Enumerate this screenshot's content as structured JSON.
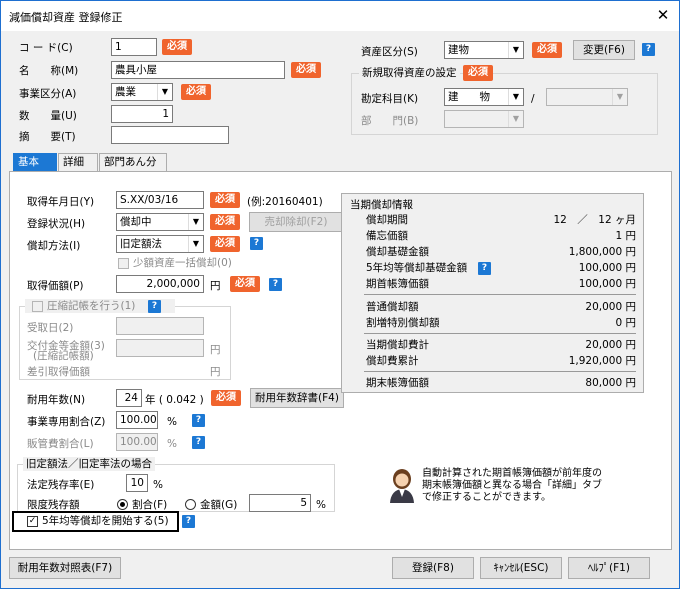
{
  "window": {
    "title": "減価償却資産 登録修正",
    "close_label": "✕"
  },
  "required_label": "必須",
  "help_label": "?",
  "header": {
    "code_label": "コ ー ド(C)",
    "code_value": "1",
    "name_label": "名　　称(M)",
    "name_value": "農具小屋",
    "business_label": "事業区分(A)",
    "business_value": "農業",
    "quantity_label": "数　　量(U)",
    "quantity_value": "1",
    "summary_label": "摘　　要(T)",
    "summary_value": "",
    "asset_class_label": "資産区分(S)",
    "asset_class_value": "建物",
    "change_button": "変更(F6)",
    "new_setting_title": "新規取得資産の設定",
    "account_label": "勘定科目(K)",
    "account_value": "建　　物",
    "account_sep": "/",
    "dept_label": "部　　門(B)"
  },
  "tabs": [
    {
      "label": "基本"
    },
    {
      "label": "詳細"
    },
    {
      "label": "部門あん分"
    }
  ],
  "form": {
    "acq_date_label": "取得年月日(Y)",
    "acq_date_value": "S.XX/03/16",
    "acq_date_example": "(例:20160401)",
    "reg_status_label": "登録状況(H)",
    "reg_status_value": "償却中",
    "sell_remove_button": "売却除却(F2)",
    "method_label": "償却方法(I)",
    "method_value": "旧定額法",
    "small_asset_label": "少額資産一括償却(0)",
    "acq_price_label": "取得価額(P)",
    "acq_price_value": "2,000,000",
    "yen": "円",
    "compress_label": "圧縮記帳を行う(1)",
    "received_date_label": "受取日(2)",
    "grant_label_1": "交付金等金額(3)",
    "grant_label_2": "(圧縮記帳額)",
    "deduct_label": "差引取得価額",
    "life_label": "耐用年数(N)",
    "life_value": "24",
    "life_unit": "年 ( 0.042 )",
    "life_table_button": "耐用年数辞書(F4)",
    "business_ratio_label": "事業専用割合(Z)",
    "business_ratio_value": "100.00",
    "pct": "%",
    "admin_ratio_label": "販管費割合(L)",
    "admin_ratio_value": "100.00",
    "old_method_title": "旧定額法／旧定率法の場合",
    "legal_residual_label": "法定残存率(E)",
    "legal_residual_value": "10",
    "limit_residual_label": "限度残存額",
    "ratio_option": "割合(F)",
    "amount_option": "金額(G)",
    "limit_residual_value": "5",
    "five_year_label": "5年均等償却を開始する(5)"
  },
  "info": {
    "title": "当期償却情報",
    "rows": [
      {
        "label": "償却期間",
        "value": "12　／　12 ヶ月"
      },
      {
        "label": "備忘価額",
        "value": "1 円"
      },
      {
        "label": "償却基礎金額",
        "value": "1,800,000 円"
      },
      {
        "label": "5年均等償却基礎金額",
        "value": "100,000 円"
      },
      {
        "label": "期首帳簿価額",
        "value": "100,000 円"
      },
      {
        "label": "普通償却額",
        "value": "20,000 円"
      },
      {
        "label": "割増特別償却額",
        "value": "0 円"
      },
      {
        "label": "当期償却費計",
        "value": "20,000 円"
      },
      {
        "label": "償却費累計",
        "value": "1,920,000 円"
      },
      {
        "label": "期末帳簿価額",
        "value": "80,000 円"
      }
    ]
  },
  "notice": {
    "line1": "自動計算された期首帳簿価額が前年度の",
    "line2": "期末帳簿価額と異なる場合「詳細」タブ",
    "line3": "で修正することができます。"
  },
  "footer": {
    "table_button": "耐用年数対照表(F7)",
    "register_button": "登録(F8)",
    "cancel_button": "ｷｬﾝｾﾙ(ESC)",
    "help_button": "ﾍﾙﾌﾟ(F1)"
  }
}
